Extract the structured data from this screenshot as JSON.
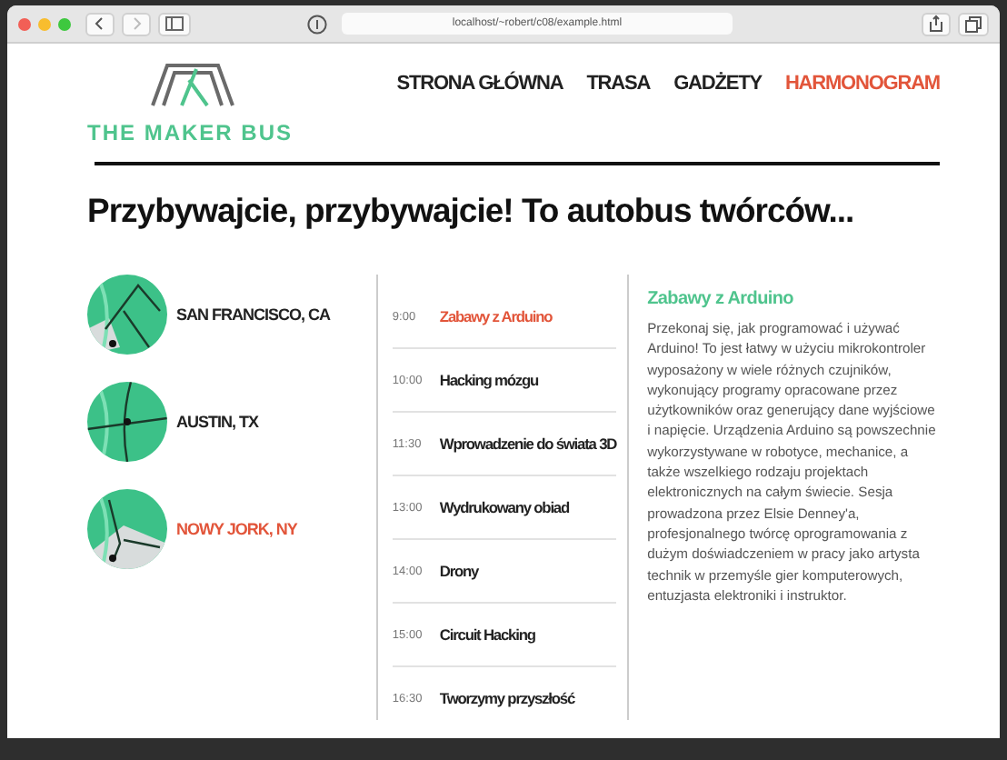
{
  "browser": {
    "url": "localhost/~robert/c08/example.html"
  },
  "logo": {
    "text": "THE MAKER BUS"
  },
  "nav": [
    {
      "label": "STRONA GŁÓWNA",
      "selected": false
    },
    {
      "label": "TRASA",
      "selected": false
    },
    {
      "label": "GADŻETY",
      "selected": false
    },
    {
      "label": "HARMONOGRAM",
      "selected": true
    }
  ],
  "heading": "Przybywajcie, przybywajcie! To autobus twórców...",
  "cities": [
    {
      "name": "SAN FRANCISCO, CA",
      "selected": false
    },
    {
      "name": "AUSTIN, TX",
      "selected": false
    },
    {
      "name": "NOWY JORK, NY",
      "selected": true
    }
  ],
  "schedule": [
    {
      "time": "9:00",
      "title": "Zabawy z Arduino",
      "selected": true
    },
    {
      "time": "10:00",
      "title": "Hacking mózgu",
      "selected": false
    },
    {
      "time": "11:30",
      "title": "Wprowadzenie do świata 3D",
      "selected": false
    },
    {
      "time": "13:00",
      "title": "Wydrukowany obiad",
      "selected": false
    },
    {
      "time": "14:00",
      "title": "Drony",
      "selected": false
    },
    {
      "time": "15:00",
      "title": "Circuit Hacking",
      "selected": false
    },
    {
      "time": "16:30",
      "title": "Tworzymy przyszłość",
      "selected": false
    }
  ],
  "detail": {
    "title": "Zabawy z Arduino",
    "text": "Przekonaj się, jak programować i używać Arduino! To jest łatwy w użyciu mikrokontroler wyposażony w wiele różnych czujników, wykonujący programy opracowane przez użytkowników oraz generujący dane wyjściowe i napięcie. Urządzenia Arduino są powszechnie wykorzystywane w robotyce, mechanice, a także wszelkiego rodzaju projektach elektronicznych na całym świecie. Sesja prowadzona przez Elsie Denney'a, profesjonalnego twórcę oprogramowania z dużym doświadczeniem w pracy jako artysta technik w przemyśle gier komputerowych, entuzjasta elektroniki i instruktor."
  }
}
